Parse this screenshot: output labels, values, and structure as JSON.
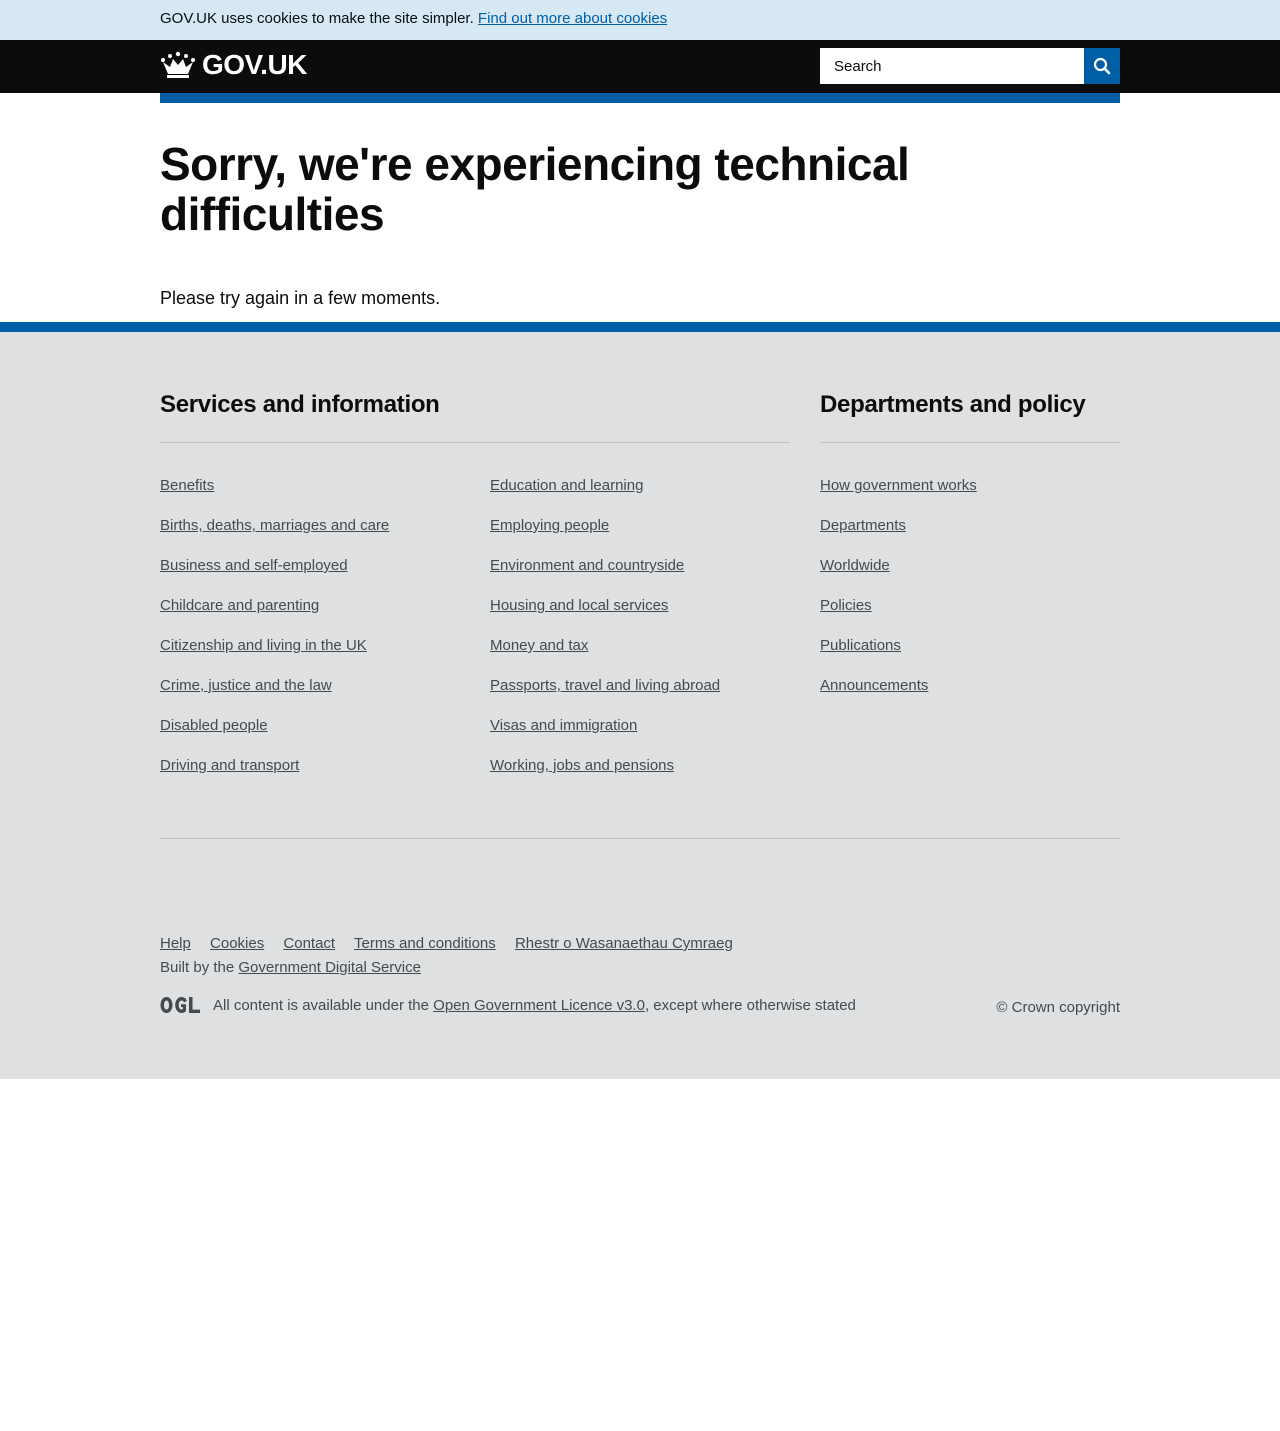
{
  "cookie_banner": {
    "text": "GOV.UK uses cookies to make the site simpler.",
    "link_text": "Find out more about cookies"
  },
  "header": {
    "logo_text": "GOV.UK",
    "search_placeholder": "Search",
    "search_icon": "search-icon"
  },
  "main": {
    "title": "Sorry, we're experiencing technical difficulties",
    "message": "Please try again in a few moments."
  },
  "footer": {
    "services_heading": "Services and information",
    "services_col1": [
      "Benefits",
      "Births, deaths, marriages and care",
      "Business and self-employed",
      "Childcare and parenting",
      "Citizenship and living in the UK",
      "Crime, justice and the law",
      "Disabled people",
      "Driving and transport"
    ],
    "services_col2": [
      "Education and learning",
      "Employing people",
      "Environment and countryside",
      "Housing and local services",
      "Money and tax",
      "Passports, travel and living abroad",
      "Visas and immigration",
      "Working, jobs and pensions"
    ],
    "departments_heading": "Departments and policy",
    "departments": [
      "How government works",
      "Departments",
      "Worldwide",
      "Policies",
      "Publications",
      "Announcements"
    ],
    "meta_links": [
      "Help",
      "Cookies",
      "Contact",
      "Terms and conditions",
      "Rhestr o Wasanaethau Cymraeg"
    ],
    "built_by_prefix": "Built by the",
    "built_by_link": "Government Digital Service",
    "licence_prefix": "All content is available under the",
    "licence_link": "Open Government Licence v3.0",
    "licence_suffix": ", except where otherwise stated",
    "copyright": "© Crown copyright"
  },
  "colors": {
    "brand_blue": "#005ea5",
    "header_black": "#0b0c0c",
    "footer_grey": "#dee0e2",
    "cookie_banner": "#d5e8f3"
  }
}
